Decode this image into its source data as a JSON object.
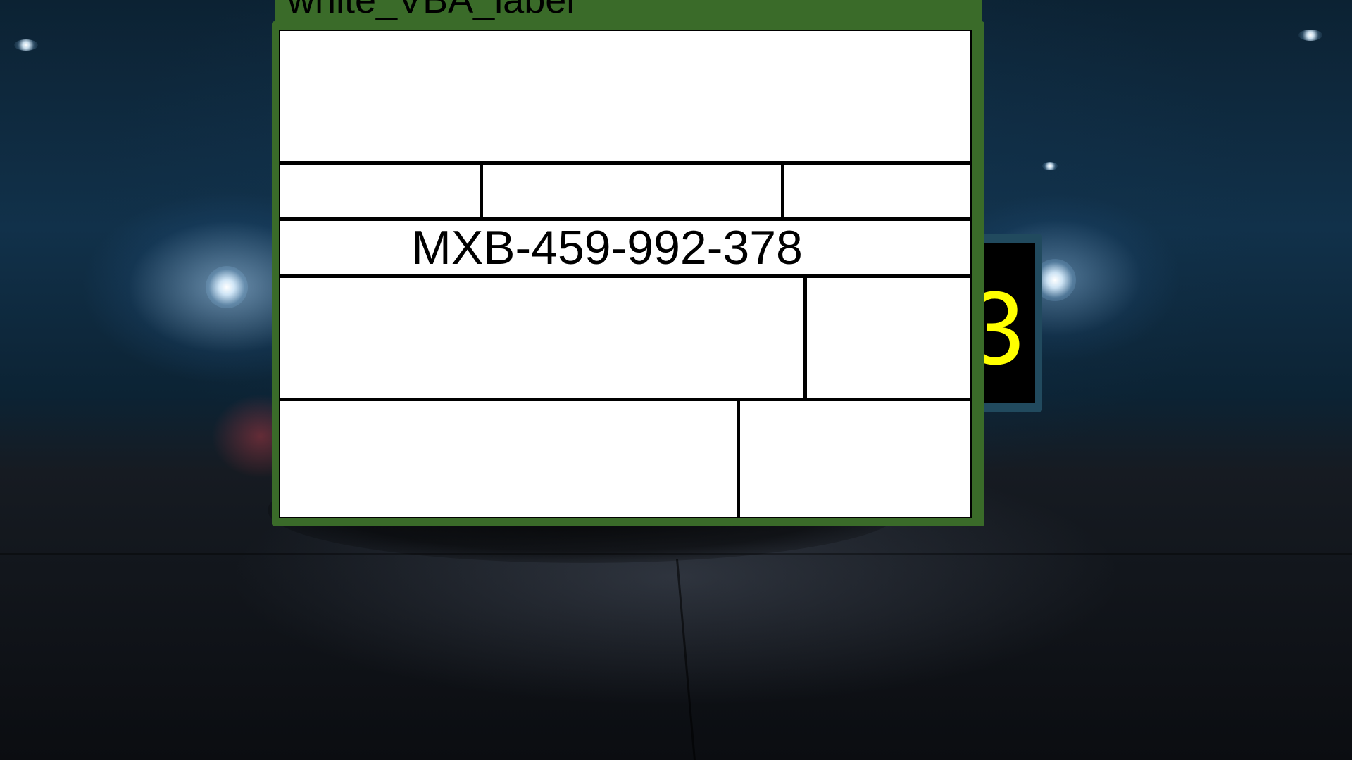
{
  "window": {
    "title": "white_VBA_label"
  },
  "label": {
    "serial_number": "MXB-459-992-378",
    "fields": {
      "header": "",
      "row2_left": "",
      "row2_middle": "",
      "row2_right": "",
      "row4_left": "",
      "row4_right": "",
      "row5_left": "",
      "row5_right": ""
    }
  },
  "background_widget": {
    "digit": "3"
  },
  "colors": {
    "frame_green": "#3a6b29",
    "counter_digit_yellow": "#ffff00",
    "counter_panel": "#214a5e"
  }
}
